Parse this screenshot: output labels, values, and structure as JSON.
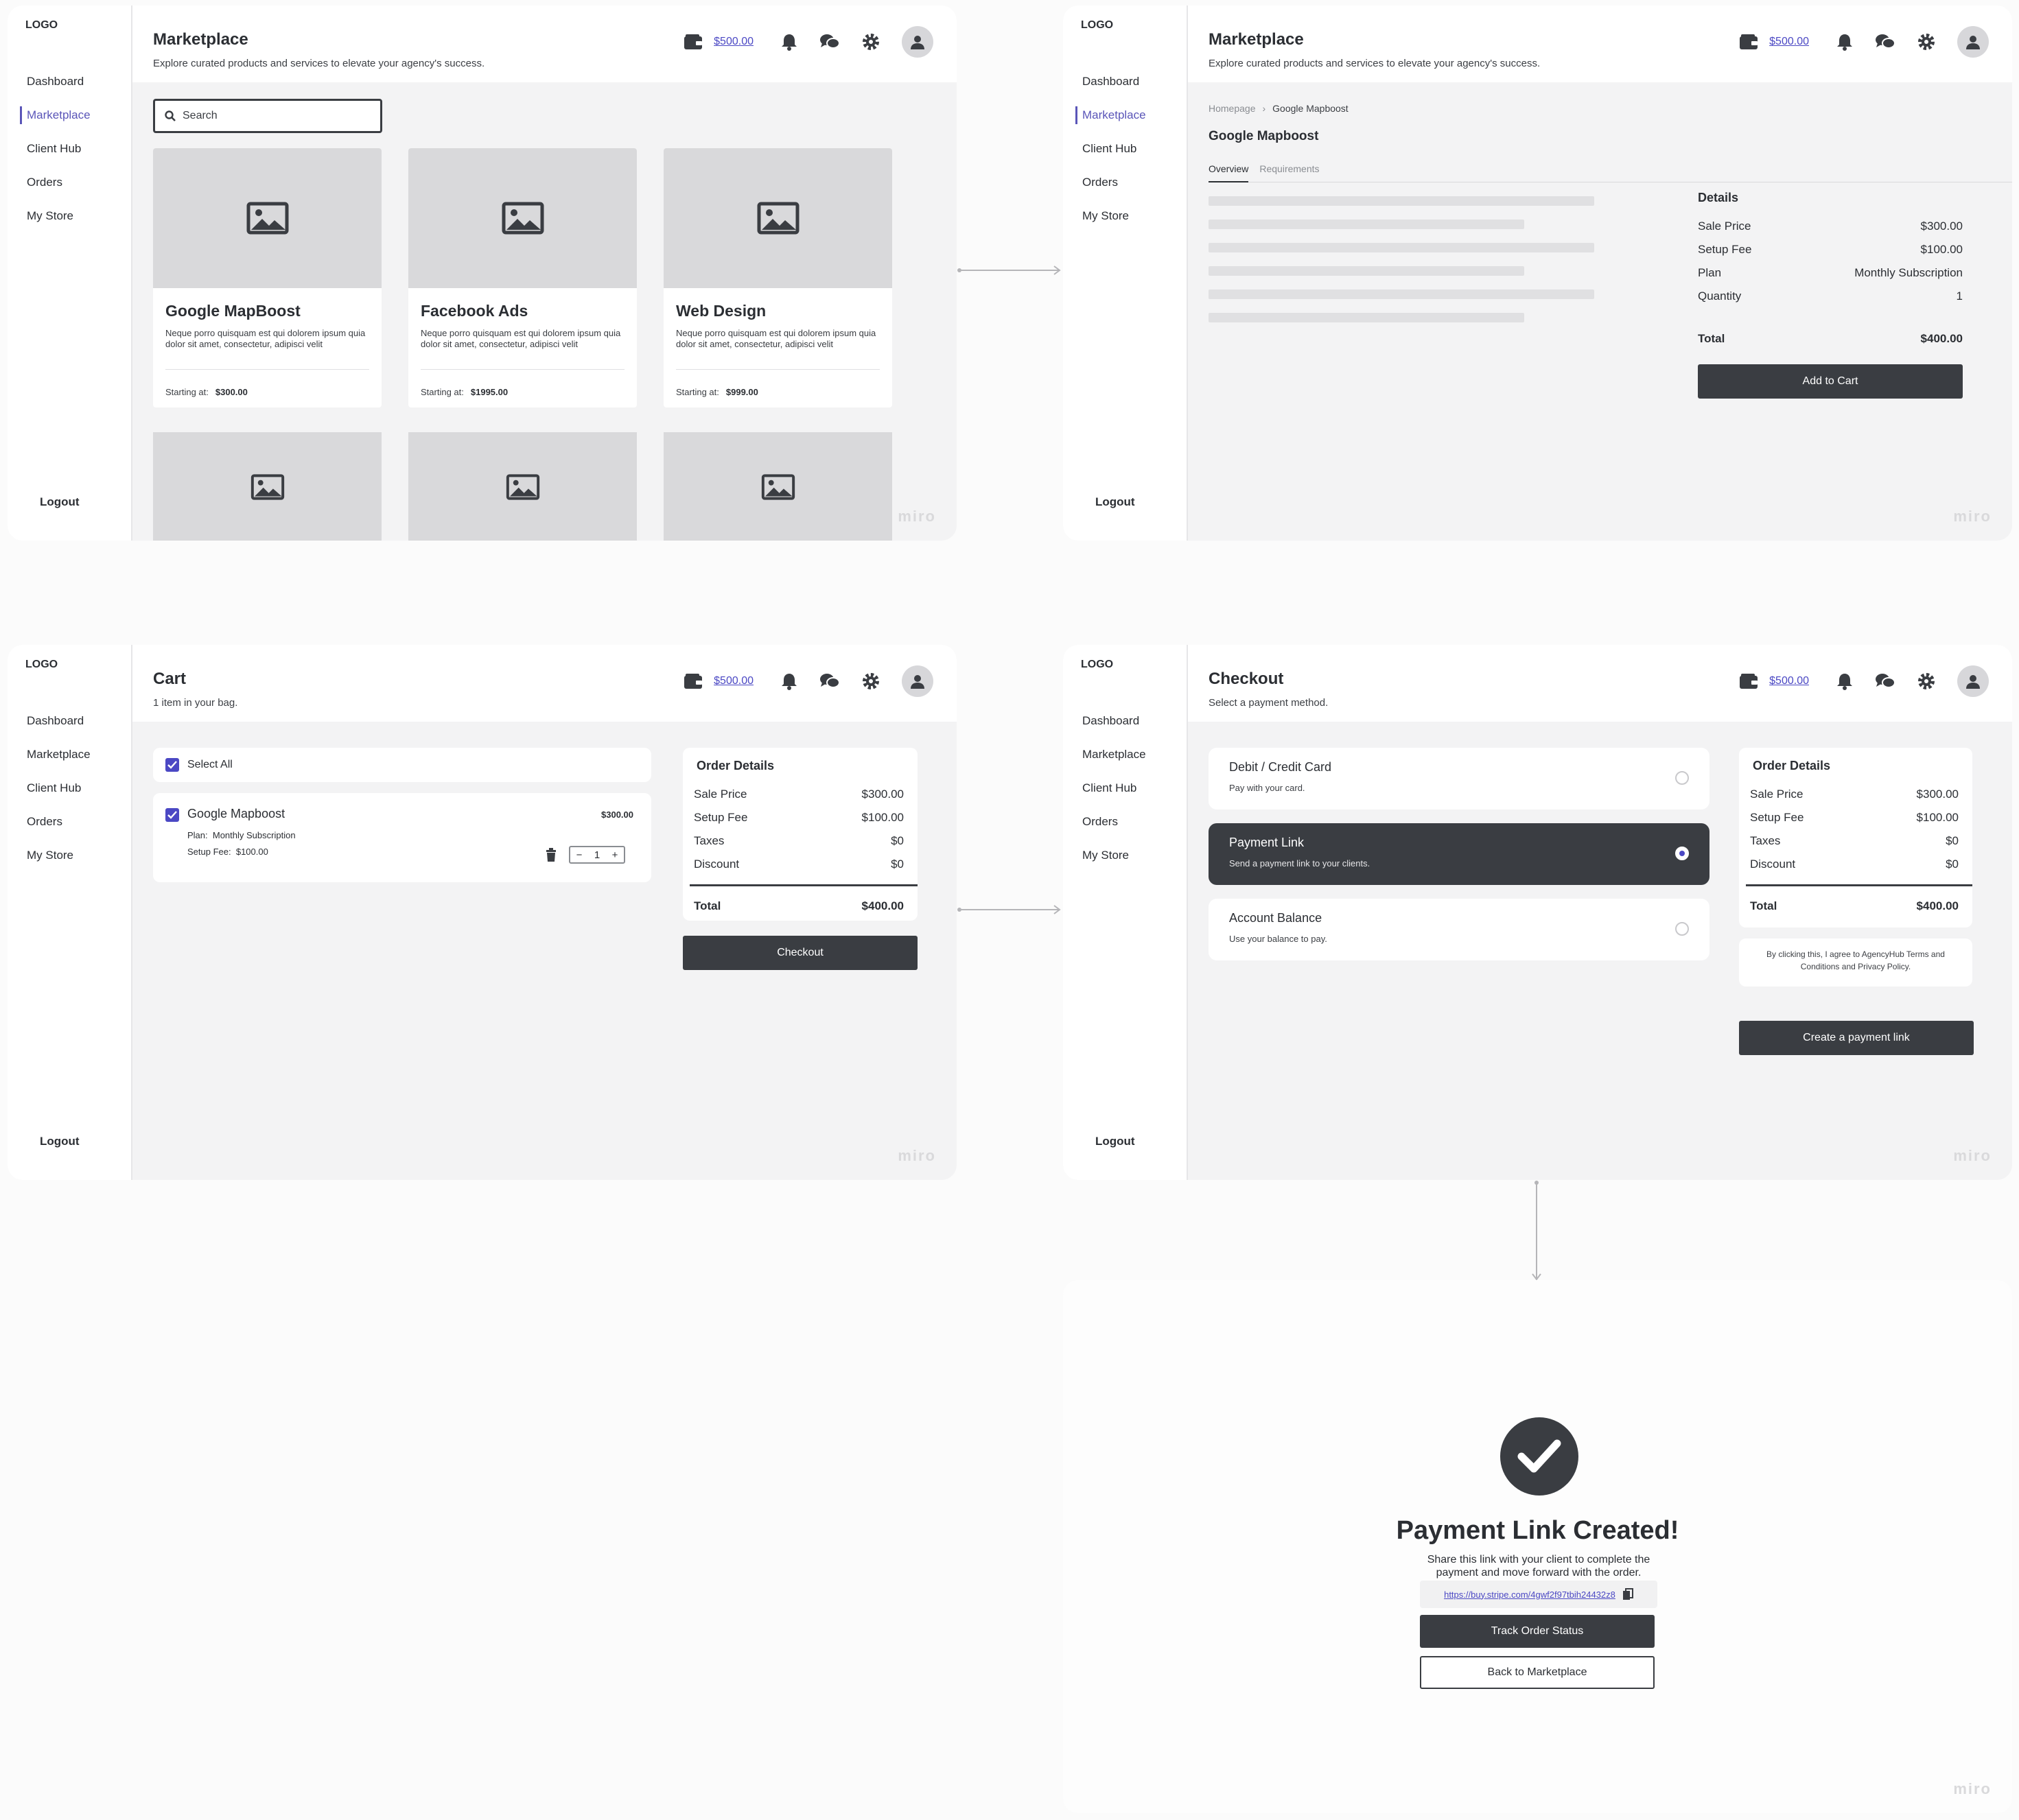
{
  "common": {
    "logo": "LOGO",
    "logout": "Logout",
    "balance": "$500.00",
    "watermark": "miro",
    "nav": [
      "Dashboard",
      "Marketplace",
      "Client Hub",
      "Orders",
      "My Store"
    ]
  },
  "marketplace": {
    "title": "Marketplace",
    "subtitle": "Explore curated products and services to elevate your agency's success.",
    "search_placeholder": "Search",
    "products": [
      {
        "name": "Google MapBoost",
        "desc": "Neque porro quisquam est qui dolorem ipsum quia dolor sit amet, consectetur, adipisci velit",
        "price_label": "Starting at:",
        "price": "$300.00"
      },
      {
        "name": "Facebook Ads",
        "desc": "Neque porro quisquam est qui dolorem ipsum quia dolor sit amet, consectetur, adipisci velit",
        "price_label": "Starting at:",
        "price": "$1995.00"
      },
      {
        "name": "Web Design",
        "desc": "Neque porro quisquam est qui dolorem ipsum quia dolor sit amet, consectetur, adipisci velit",
        "price_label": "Starting at:",
        "price": "$999.00"
      }
    ]
  },
  "product_detail": {
    "title": "Marketplace",
    "subtitle": "Explore curated products and services to elevate your agency's success.",
    "breadcrumb": [
      "Homepage",
      "Google Mapboost"
    ],
    "product_title": "Google Mapboost",
    "tabs": [
      "Overview",
      "Requirements"
    ],
    "details": {
      "heading": "Details",
      "rows": [
        {
          "label": "Sale Price",
          "value": "$300.00"
        },
        {
          "label": "Setup Fee",
          "value": "$100.00"
        },
        {
          "label": "Plan",
          "value": "Monthly Subscription"
        },
        {
          "label": "Quantity",
          "value": "1"
        }
      ],
      "total_label": "Total",
      "total_value": "$400.00",
      "button": "Add to Cart"
    }
  },
  "cart": {
    "title": "Cart",
    "subtitle": "1 item in your bag.",
    "select_all": "Select All",
    "item": {
      "name": "Google Mapboost",
      "price": "$300.00",
      "plan_label": "Plan:",
      "plan_value": "Monthly Subscription",
      "fee_label": "Setup Fee:",
      "fee_value": "$100.00",
      "quantity": "1"
    },
    "order": {
      "heading": "Order Details",
      "rows": [
        {
          "label": "Sale Price",
          "value": "$300.00"
        },
        {
          "label": "Setup Fee",
          "value": "$100.00"
        },
        {
          "label": "Taxes",
          "value": "$0"
        },
        {
          "label": "Discount",
          "value": "$0"
        }
      ],
      "total_label": "Total",
      "total_value": "$400.00",
      "button": "Checkout"
    }
  },
  "checkout": {
    "title": "Checkout",
    "subtitle": "Select a payment method.",
    "methods": [
      {
        "title": "Debit / Credit Card",
        "desc": "Pay with your card."
      },
      {
        "title": "Payment Link",
        "desc": "Send a payment link to your clients."
      },
      {
        "title": "Account Balance",
        "desc": "Use your balance to pay."
      }
    ],
    "selected_method": "Payment Link",
    "order": {
      "heading": "Order Details",
      "rows": [
        {
          "label": "Sale Price",
          "value": "$300.00"
        },
        {
          "label": "Setup Fee",
          "value": "$100.00"
        },
        {
          "label": "Taxes",
          "value": "$0"
        },
        {
          "label": "Discount",
          "value": "$0"
        }
      ],
      "total_label": "Total",
      "total_value": "$400.00"
    },
    "terms": "By clicking this, I agree to AgencyHub Terms and Conditions and Privacy Policy.",
    "button": "Create a payment link"
  },
  "confirmation": {
    "title": "Payment Link Created!",
    "subtitle": "Share this link with your client to complete the payment and move forward with the order.",
    "link": "https://buy.stripe.com/4gwf2f97tbih24432z8",
    "primary_button": "Track Order Status",
    "secondary_button": "Back to Marketplace"
  },
  "colors": {
    "accent": "#4b48c4",
    "dark": "#3a3d42",
    "placeholder": "#d9d9db"
  },
  "icons": [
    "wallet-icon",
    "bell-icon",
    "chat-icon",
    "gear-icon",
    "user-icon",
    "image-icon",
    "search-icon",
    "trash-icon",
    "copy-icon",
    "check-icon"
  ]
}
